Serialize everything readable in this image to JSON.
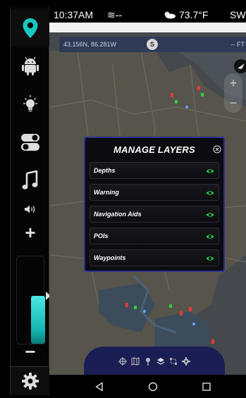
{
  "status_bar": {
    "time": "10:37AM",
    "wave": "≋--",
    "temperature": "73.7°F",
    "wind_dir": "SW"
  },
  "map": {
    "coordinates": "43.156N, 86.281W",
    "satellite_count": "S",
    "depth_unit": "-- FT",
    "zoom_in": "+",
    "zoom_out": "−"
  },
  "rail": {
    "items": [
      {
        "icon": "location-pin-icon",
        "active": true
      },
      {
        "icon": "android-icon",
        "active": false
      },
      {
        "icon": "light-bulb-icon",
        "active": false
      },
      {
        "icon": "toggle-switch-icon",
        "active": false
      },
      {
        "icon": "music-note-icon",
        "active": false
      },
      {
        "icon": "speaker-volume-icon",
        "active": false
      },
      {
        "icon": "volume-plus-icon",
        "active": false
      },
      {
        "icon": "volume-minus-icon",
        "active": false
      },
      {
        "icon": "gear-icon",
        "active": false
      }
    ],
    "volume_level": 0.55,
    "volume_plus": "+",
    "volume_minus": "−"
  },
  "dialog": {
    "title": "MANAGE LAYERS",
    "layers": [
      {
        "label": "Depths",
        "visible": true
      },
      {
        "label": "Warning",
        "visible": true
      },
      {
        "label": "Navigation Aids",
        "visible": true
      },
      {
        "label": "POIs",
        "visible": true
      },
      {
        "label": "Waypoints",
        "visible": true
      }
    ]
  },
  "toolbar": {
    "icons": [
      "crosshair-icon",
      "map-icon",
      "pin-icon",
      "layers-icon",
      "route-icon",
      "gear-icon"
    ]
  },
  "colors": {
    "accent": "#18c6c0",
    "eye": "#21d24a",
    "dialog_border": "#2b2f8f",
    "toolbar": "#1b1d55"
  },
  "navbar": {
    "icons": [
      "back-icon",
      "home-icon",
      "recents-icon"
    ]
  }
}
